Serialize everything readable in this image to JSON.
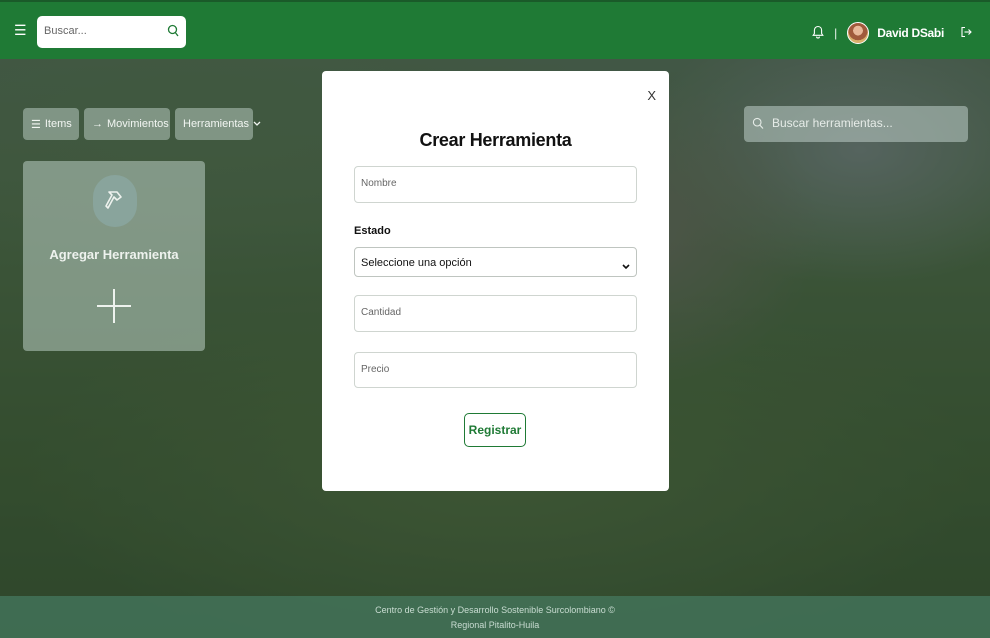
{
  "header": {
    "search_placeholder": "Buscar...",
    "separator": "|",
    "user_name": "David DSabi"
  },
  "toolbar": {
    "items_label": "Items",
    "movimientos_label": "Movimientos",
    "herramientas_label": "Herramientas",
    "search_placeholder": "Buscar herramientas..."
  },
  "add_card": {
    "title": "Agregar Herramienta"
  },
  "modal": {
    "close_label": "X",
    "title": "Crear Herramienta",
    "nombre_placeholder": "Nombre",
    "estado_label": "Estado",
    "estado_selected": "Seleccione una opción",
    "cantidad_placeholder": "Cantidad",
    "precio_placeholder": "Precio",
    "submit_label": "Registrar"
  },
  "footer": {
    "line1": "Centro de Gestión y Desarrollo Sostenible Surcolombiano ©",
    "line2": "Regional Pitalito-Huila"
  },
  "colors": {
    "header_bg": "#1f7a35",
    "accent": "#1f7a35"
  },
  "icons": [
    "menu-icon",
    "search-icon",
    "bell-icon",
    "avatar",
    "logout-icon",
    "list-icon",
    "arrow-right-icon",
    "chevron-down-icon",
    "hammer-icon",
    "plus-icon",
    "close-icon"
  ]
}
